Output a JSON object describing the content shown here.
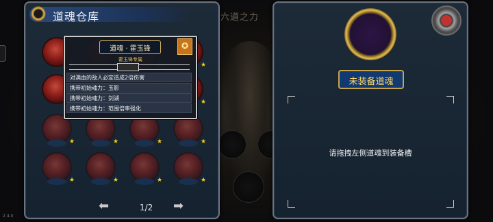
{
  "app": {
    "version": "2.4.0"
  },
  "background": {
    "title": "六道之力"
  },
  "storage": {
    "title": "道魂仓库",
    "page_indicator": "1/2",
    "emblem_icon": "soul-emblem-icon",
    "prev_icon": "arrow-left-icon",
    "next_icon": "arrow-right-icon",
    "star_glyph": "★",
    "slots_total": 16
  },
  "tooltip": {
    "name": "道魂 · 霍玉锋",
    "subtitle": "霍玉锋专属",
    "badge": "✪",
    "lines": [
      "对满血的敌人必定造成2倍伤害",
      "携带初始魂力：玉影",
      "携带初始魂力：剑湖",
      "携带初始魂力：范围倍率强化"
    ]
  },
  "equip": {
    "label": "未装备道魂",
    "hint": "请拖拽左侧道魂到装备槽"
  },
  "colors": {
    "accent_gold": "#d6b35e",
    "soul_red": "#8e1f1a",
    "star_yellow": "#f6d31a",
    "label_blue": "#123a72"
  }
}
